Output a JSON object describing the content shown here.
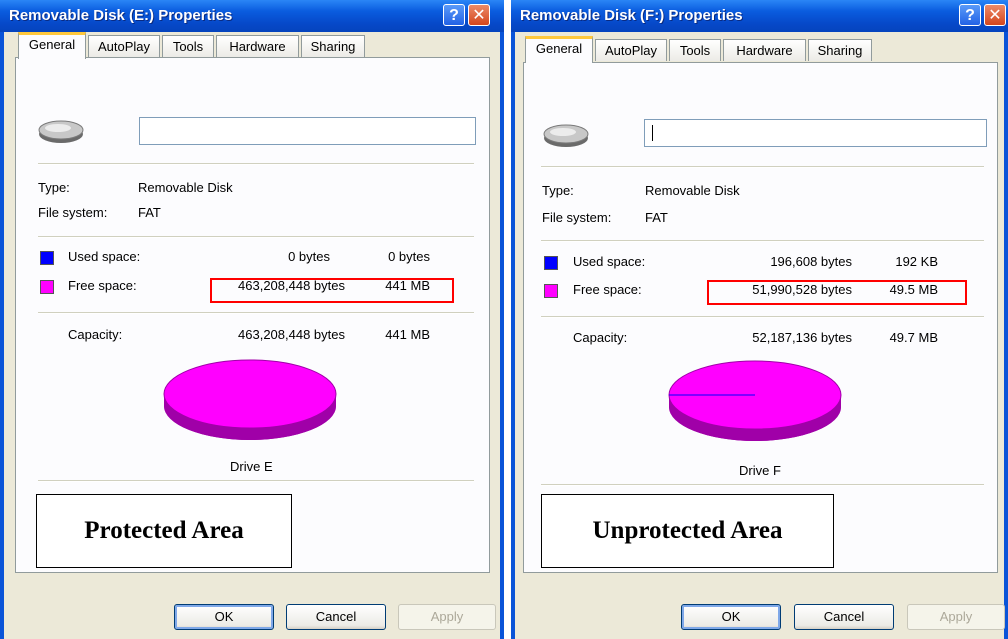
{
  "windows": [
    {
      "title": "Removable Disk (E:) Properties",
      "tabs": [
        "General",
        "AutoPlay",
        "Tools",
        "Hardware",
        "Sharing"
      ],
      "active_tab": "General",
      "name_value": "",
      "type_label": "Type:",
      "type_value": "Removable Disk",
      "fs_label": "File system:",
      "fs_value": "FAT",
      "used_label": "Used space:",
      "used_bytes": "0 bytes",
      "used_size": "0 bytes",
      "free_label": "Free space:",
      "free_bytes": "463,208,448 bytes",
      "free_size": "441 MB",
      "capacity_label": "Capacity:",
      "capacity_bytes": "463,208,448 bytes",
      "capacity_size": "441 MB",
      "drive_label": "Drive E",
      "annotation": "Protected Area",
      "buttons": {
        "ok": "OK",
        "cancel": "Cancel",
        "apply": "Apply"
      },
      "used_fraction": 0.0
    },
    {
      "title": "Removable Disk (F:) Properties",
      "tabs": [
        "General",
        "AutoPlay",
        "Tools",
        "Hardware",
        "Sharing"
      ],
      "active_tab": "General",
      "name_value": "",
      "type_label": "Type:",
      "type_value": "Removable Disk",
      "fs_label": "File system:",
      "fs_value": "FAT",
      "used_label": "Used space:",
      "used_bytes": "196,608 bytes",
      "used_size": "192 KB",
      "free_label": "Free space:",
      "free_bytes": "51,990,528 bytes",
      "free_size": "49.5 MB",
      "capacity_label": "Capacity:",
      "capacity_bytes": "52,187,136 bytes",
      "capacity_size": "49.7 MB",
      "drive_label": "Drive F",
      "annotation": "Unprotected Area",
      "buttons": {
        "ok": "OK",
        "cancel": "Cancel",
        "apply": "Apply"
      },
      "used_fraction": 0.0038
    }
  ],
  "colors": {
    "used": "#0000ff",
    "free": "#ff00ff",
    "free_dark": "#a000a8",
    "highlight_box": "#ff0000"
  },
  "icons": [
    "help-icon",
    "close-icon",
    "removable-disk-icon"
  ]
}
